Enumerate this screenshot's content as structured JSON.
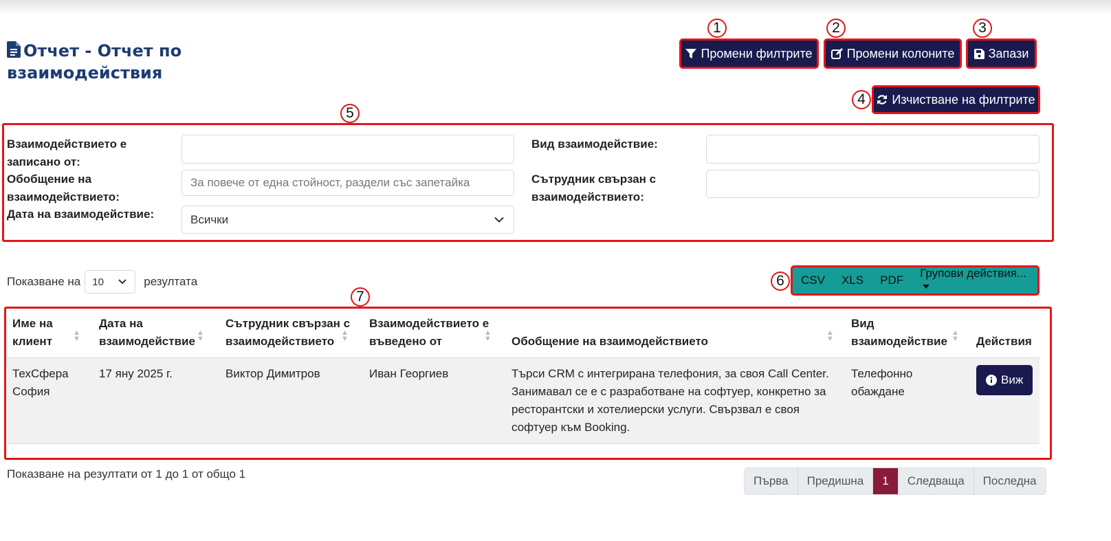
{
  "page": {
    "title": "Отчет - Отчет по взаимодействия"
  },
  "toolbar": {
    "change_filters": "Промени филтрите",
    "change_columns": "Промени колоните",
    "save": "Запази",
    "clear_filters": "Изчистване на филтрите"
  },
  "markers": [
    "1",
    "2",
    "3",
    "4",
    "5",
    "6",
    "7"
  ],
  "filters": {
    "recorded_by_label": "Взаимодействието е записано от:",
    "recorded_by_value": "",
    "summary_label": "Обобщение на взаимодействието:",
    "summary_placeholder": "За повече от една стойност, раздели със запетайка",
    "date_label": "Дата на взаимодействие:",
    "date_value": "Всички",
    "type_label": "Вид взаимодействие:",
    "type_value": "",
    "employee_label": "Сътрудник свързан с взаимодействието:",
    "employee_value": ""
  },
  "list_controls": {
    "show_prefix": "Показване на",
    "page_size": "10",
    "show_suffix": "резултата"
  },
  "export": {
    "csv": "CSV",
    "xls": "XLS",
    "pdf": "PDF",
    "bulk": "Групови действия..."
  },
  "table": {
    "headers": [
      "Име на клиент",
      "Дата на взаимодействие",
      "Сътрудник свързан с взаимодействието",
      "Взаимодействието е въведено от",
      "Обобщение на взаимодействието",
      "Вид взаимодействие",
      "Действия"
    ],
    "rows": [
      {
        "client": "ТехСфера София",
        "date": "17 яну 2025 г.",
        "employee": "Виктор Димитров",
        "entered_by": "Иван Георгиев",
        "summary": "Търси CRM с интегрирана телефония, за своя Call Center. Занимавал се е с разработване на софтуер, конкретно за ресторантски и хотелиерски услуги. Свързвал е своя софтуер към Booking.",
        "type": "Телефонно обаждане",
        "action": "Виж"
      }
    ]
  },
  "footer": {
    "info": "Показване на резултати от 1 до 1 от общо 1"
  },
  "pagination": {
    "first": "Първа",
    "prev": "Предишна",
    "current": "1",
    "next": "Следваща",
    "last": "Последна"
  },
  "colors": {
    "primary": "#1a1a4e",
    "title": "#1d3c73",
    "teal": "#169c97",
    "active_page": "#8b1a3a",
    "highlight": "#e3151a"
  }
}
